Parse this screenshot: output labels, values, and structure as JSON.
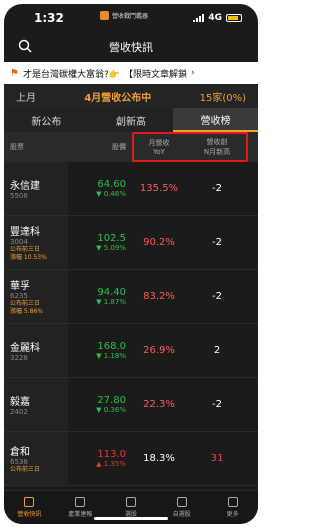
{
  "status": {
    "time": "1:32",
    "center_text": "營收戰鬥鑑器",
    "network": "4G"
  },
  "nav": {
    "title": "營收快訊"
  },
  "ticker": {
    "text": "才是台灣碳權大富翁?👉",
    "text2": "【限時文章解鎖",
    "arrow": "›"
  },
  "monthbar": {
    "left": "上月",
    "center": "4月營收公布中",
    "right": "15家(0%)"
  },
  "tabs": [
    {
      "label": "新公布"
    },
    {
      "label": "創新高"
    },
    {
      "label": "營收榜"
    }
  ],
  "header": {
    "name": "股票",
    "price": "股價",
    "yoy_line1": "月營收",
    "yoy_line2": "YoY",
    "nhigh_line1": "營收創",
    "nhigh_line2": "N月新高"
  },
  "rows": [
    {
      "name": "永信建",
      "code": "5508",
      "tag1": "",
      "tag2": "",
      "price": "64.60",
      "change": "▼ 0.46%",
      "dir": "up",
      "yoy": "135.5%",
      "nhigh": "-2"
    },
    {
      "name": "豐達科",
      "code": "3004",
      "tag1": "公布前三日",
      "tag2": "漲幅 10.53%",
      "price": "102.5",
      "change": "▼ 5.09%",
      "dir": "up",
      "yoy": "90.2%",
      "nhigh": "-2"
    },
    {
      "name": "華孚",
      "code": "6235",
      "tag1": "公布前三日",
      "tag2": "漲幅 5.86%",
      "price": "94.40",
      "change": "▼ 1.87%",
      "dir": "up",
      "yoy": "83.2%",
      "nhigh": "-2"
    },
    {
      "name": "金麗科",
      "code": "3228",
      "tag1": "",
      "tag2": "",
      "price": "168.0",
      "change": "▼ 1.18%",
      "dir": "up",
      "yoy": "26.9%",
      "nhigh": "2"
    },
    {
      "name": "毅嘉",
      "code": "2402",
      "tag1": "",
      "tag2": "",
      "price": "27.80",
      "change": "▼ 0.36%",
      "dir": "up",
      "yoy": "22.3%",
      "nhigh": "-2"
    },
    {
      "name": "倉和",
      "code": "6538",
      "tag1": "公布前三日",
      "tag2": "",
      "price": "113.0",
      "change": "▲ 1.35%",
      "dir": "down",
      "yoy": "18.3%",
      "nhigh": "31"
    }
  ],
  "bottom_tabs": [
    {
      "label": "營收快訊",
      "icon": "news-icon"
    },
    {
      "label": "產業連報",
      "icon": "report-icon"
    },
    {
      "label": "選股",
      "icon": "cube-icon"
    },
    {
      "label": "自選股",
      "icon": "plus-box-icon"
    },
    {
      "label": "更多",
      "icon": "more-icon"
    }
  ],
  "colors": {
    "accent": "#f2a12f",
    "up": "#29c24a",
    "down": "#e23b3b",
    "highlight_box": "#e01b1b"
  }
}
